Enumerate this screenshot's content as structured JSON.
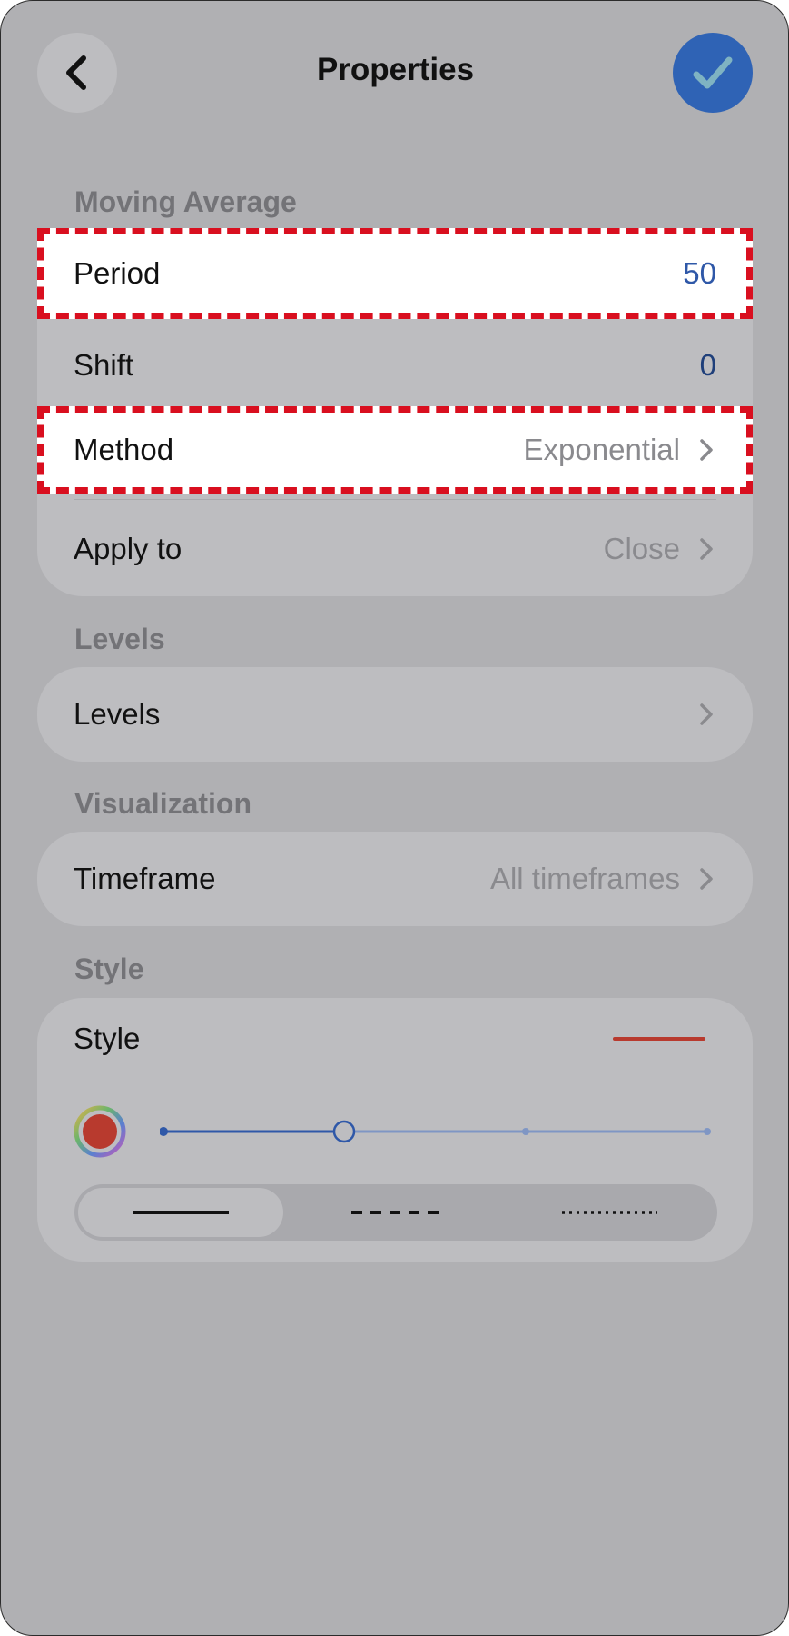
{
  "header": {
    "title": "Properties",
    "back_icon": "chevron-left-icon",
    "confirm_icon": "checkmark-icon"
  },
  "sections": {
    "moving_average": {
      "label": "Moving Average",
      "rows": [
        {
          "label": "Period",
          "value": "50"
        },
        {
          "label": "Shift",
          "value": "0"
        },
        {
          "label": "Method",
          "value": "Exponential"
        },
        {
          "label": "Apply to",
          "value": "Close"
        }
      ]
    },
    "levels": {
      "label": "Levels",
      "rows": [
        {
          "label": "Levels"
        }
      ]
    },
    "visualization": {
      "label": "Visualization",
      "rows": [
        {
          "label": "Timeframe",
          "value": "All timeframes"
        }
      ]
    },
    "style": {
      "label": "Style",
      "row_label": "Style",
      "line_color": "#b83a2e",
      "thickness_level": 2,
      "thickness_steps": 4,
      "line_styles": [
        "solid",
        "dashed",
        "dotted"
      ],
      "selected_line_style": "solid"
    }
  },
  "colors": {
    "accent": "#2f63b5",
    "highlight_border": "#d90f1f",
    "overlay_bg": "#b0b0b3"
  }
}
